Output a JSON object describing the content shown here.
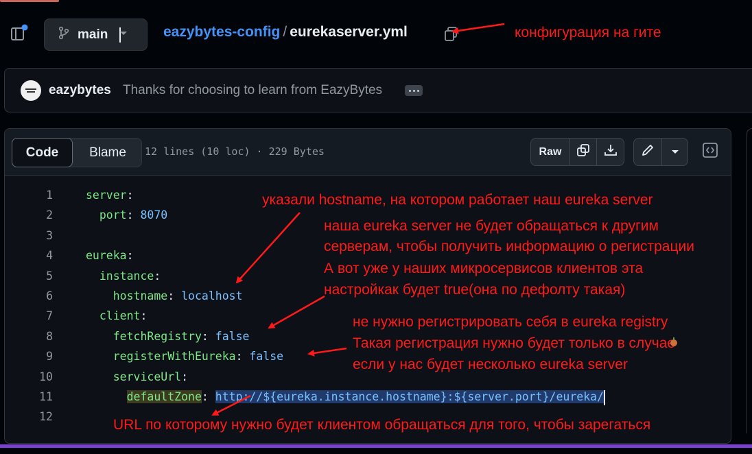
{
  "header": {
    "branch": "main",
    "repo": "eazybytes-config",
    "separator": "/",
    "file": "eurekaserver.yml"
  },
  "commit": {
    "author": "eazybytes",
    "message": "Thanks for choosing to learn from EazyBytes"
  },
  "file_view": {
    "tabs": [
      "Code",
      "Blame"
    ],
    "meta": "12 lines (10 loc) · 229 Bytes",
    "raw_label": "Raw"
  },
  "code": [
    {
      "n": "1",
      "indent": "",
      "key": "server",
      "value": ""
    },
    {
      "n": "2",
      "indent": "  ",
      "key": "port",
      "value": "8070"
    },
    {
      "n": "3",
      "indent": "",
      "key": "",
      "value": ""
    },
    {
      "n": "4",
      "indent": "",
      "key": "eureka",
      "value": ""
    },
    {
      "n": "5",
      "indent": "  ",
      "key": "instance",
      "value": ""
    },
    {
      "n": "6",
      "indent": "    ",
      "key": "hostname",
      "value": "localhost"
    },
    {
      "n": "7",
      "indent": "  ",
      "key": "client",
      "value": ""
    },
    {
      "n": "8",
      "indent": "    ",
      "key": "fetchRegistry",
      "value": "false"
    },
    {
      "n": "9",
      "indent": "    ",
      "key": "registerWithEureka",
      "value": "false"
    },
    {
      "n": "10",
      "indent": "    ",
      "key": "serviceUrl",
      "value": ""
    },
    {
      "n": "11",
      "indent": "      ",
      "key": "defaultZone",
      "value": "http://${eureka.instance.hostname}:${server.port}/eureka/"
    },
    {
      "n": "12",
      "indent": "",
      "key": "",
      "value": ""
    }
  ],
  "annotations": {
    "config_on_git": "конфигурация на гите",
    "hostname_note": "указали hostname, на котором работает наш eureka server",
    "fetch_line1": "наша eureka server не будет обращаться к другим",
    "fetch_line2": "серверам, чтобы получить информацию о регистрации",
    "fetch_line3": "А вот уже у наших микросервисов клиентов эта",
    "fetch_line4": "настройкак будет true(она по дефолту такая)",
    "register_line1": "не нужно регистрировать себя в eureka registry",
    "register_line2": "Такая регистрация нужно будет только в случае",
    "register_line3": "если у нас будет несколько eureka server",
    "url_note": "URL по которому нужно будет клиентом обращаться для того, чтобы зарегаться"
  },
  "colors": {
    "annotation": "#ff1a1a",
    "link": "#4493f8",
    "yaml_key": "#7ee787",
    "yaml_value": "#79c0ff",
    "accent_bar": "#7b3fd4"
  }
}
